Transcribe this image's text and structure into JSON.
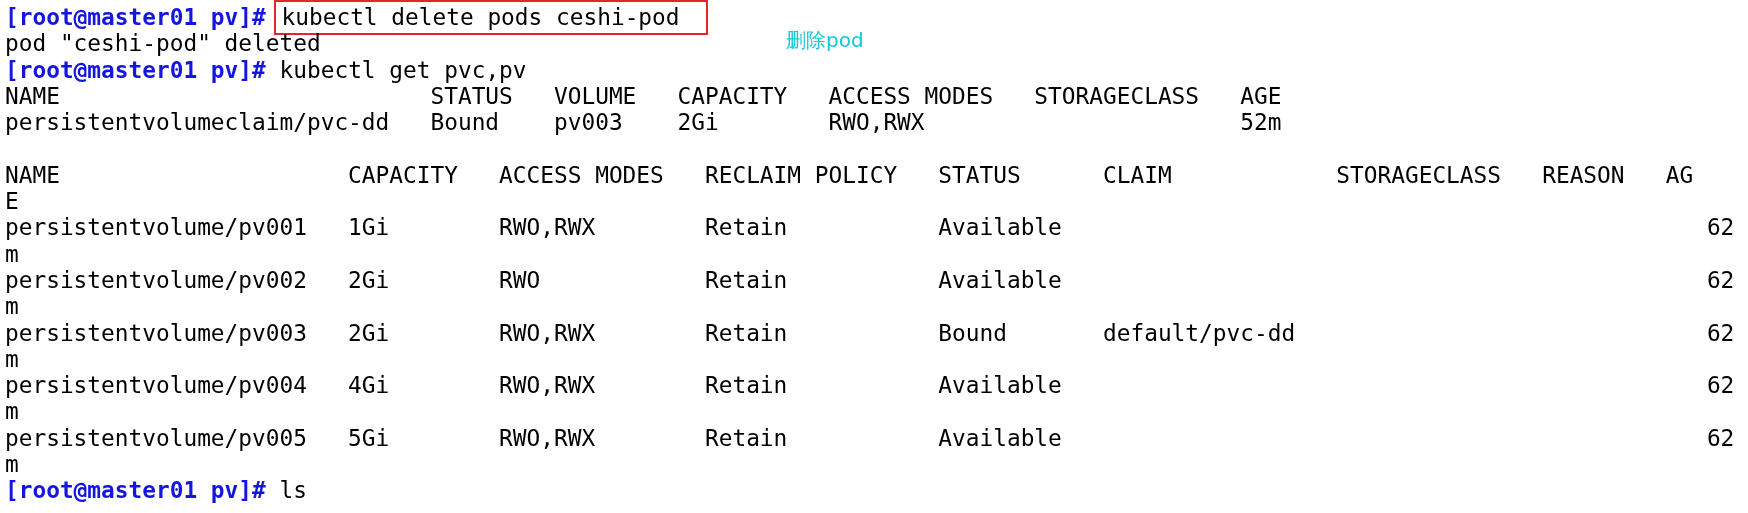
{
  "terminal": {
    "lines": [
      {
        "kind": "prompt",
        "prompt": "[root@master01 pv]#",
        "command": "kubectl delete pods ceshi-pod",
        "highlighted": true
      },
      {
        "kind": "output",
        "text": "pod \"ceshi-pod\" deleted"
      },
      {
        "kind": "prompt",
        "prompt": "[root@master01 pv]#",
        "command": "kubectl get pvc,pv",
        "highlighted": false
      },
      {
        "kind": "output",
        "text": "NAME                           STATUS   VOLUME   CAPACITY   ACCESS MODES   STORAGECLASS   AGE"
      },
      {
        "kind": "output",
        "text": "persistentvolumeclaim/pvc-dd   Bound    pv003    2Gi        RWO,RWX                       52m"
      },
      {
        "kind": "blank"
      },
      {
        "kind": "output",
        "text": "NAME                     CAPACITY   ACCESS MODES   RECLAIM POLICY   STATUS      CLAIM            STORAGECLASS   REASON   AG"
      },
      {
        "kind": "output",
        "text": "E"
      },
      {
        "kind": "output",
        "text": "persistentvolume/pv001   1Gi        RWO,RWX        Retain           Available                                               62"
      },
      {
        "kind": "output",
        "text": "m"
      },
      {
        "kind": "output",
        "text": "persistentvolume/pv002   2Gi        RWO            Retain           Available                                               62"
      },
      {
        "kind": "output",
        "text": "m"
      },
      {
        "kind": "output",
        "text": "persistentvolume/pv003   2Gi        RWO,RWX        Retain           Bound       default/pvc-dd                              62"
      },
      {
        "kind": "output",
        "text": "m"
      },
      {
        "kind": "output",
        "text": "persistentvolume/pv004   4Gi        RWO,RWX        Retain           Available                                               62"
      },
      {
        "kind": "output",
        "text": "m"
      },
      {
        "kind": "output",
        "text": "persistentvolume/pv005   5Gi        RWO,RWX        Retain           Available                                               62"
      },
      {
        "kind": "output",
        "text": "m"
      },
      {
        "kind": "prompt",
        "prompt": "[root@master01 pv]#",
        "command": "ls",
        "highlighted": false
      }
    ]
  },
  "annotation": {
    "text": "删除pod"
  }
}
